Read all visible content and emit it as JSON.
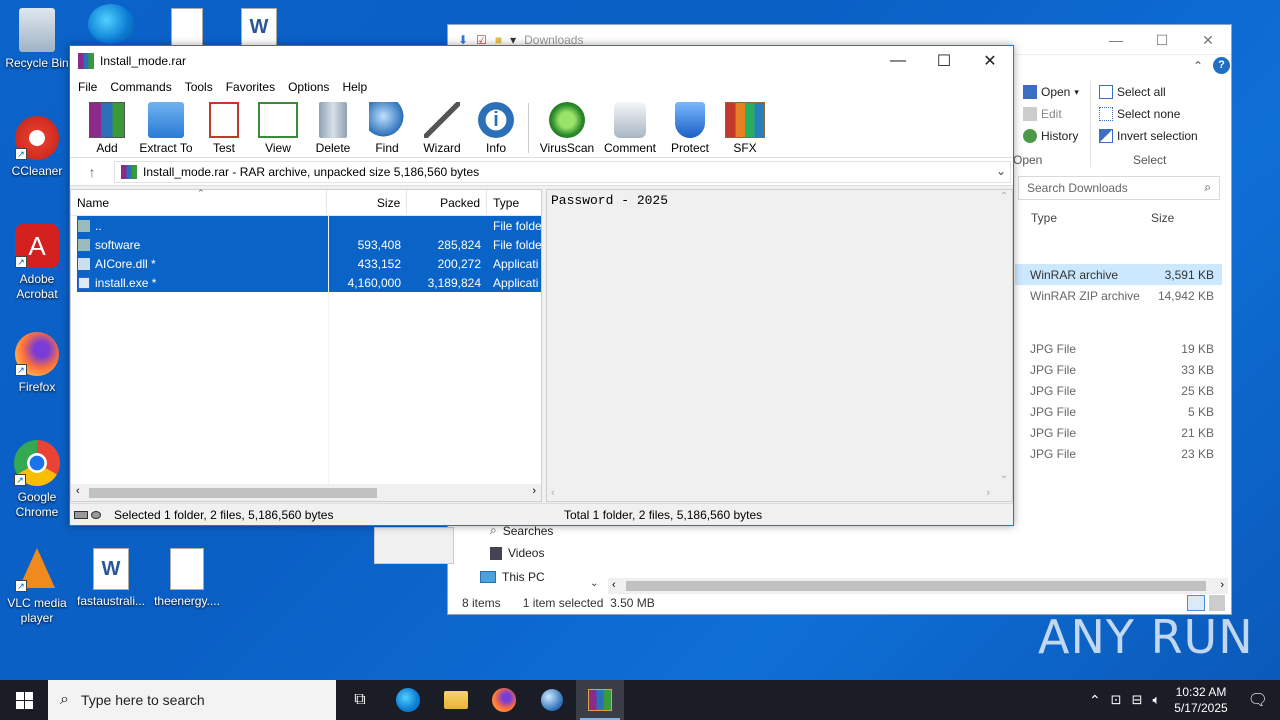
{
  "desktop": {
    "icons": [
      {
        "label": "Recycle Bin"
      },
      {
        "label": "CCleaner"
      },
      {
        "label": "Adobe Acrobat"
      },
      {
        "label": "Firefox"
      },
      {
        "label": "Google Chrome"
      },
      {
        "label": "VLC media player"
      },
      {
        "label": "fastaustrali..."
      },
      {
        "label": "theenergy...."
      }
    ]
  },
  "explorer": {
    "title": "Downloads",
    "ribbon": {
      "open": "Open",
      "edit": "Edit",
      "history": "History",
      "open_group": "Open",
      "select_all": "Select all",
      "select_none": "Select none",
      "invert_selection": "Invert selection",
      "select_group": "Select"
    },
    "search_placeholder": "Search Downloads",
    "columns": {
      "type": "Type",
      "size": "Size"
    },
    "files": [
      {
        "type": "WinRAR archive",
        "size": "3,591 KB",
        "selected": true
      },
      {
        "type": "WinRAR ZIP archive",
        "size": "14,942 KB"
      },
      {
        "type": "JPG File",
        "size": "19 KB"
      },
      {
        "type": "JPG File",
        "size": "33 KB"
      },
      {
        "type": "JPG File",
        "size": "25 KB"
      },
      {
        "type": "JPG File",
        "size": "5 KB"
      },
      {
        "type": "JPG File",
        "size": "21 KB"
      },
      {
        "type": "JPG File",
        "size": "23 KB"
      }
    ],
    "nav": {
      "searches": "Searches",
      "videos": "Videos",
      "this_pc": "This PC"
    },
    "status": {
      "items": "8 items",
      "selected": "1 item selected",
      "size": "3.50 MB"
    }
  },
  "winrar": {
    "title": "Install_mode.rar",
    "menu": [
      "File",
      "Commands",
      "Tools",
      "Favorites",
      "Options",
      "Help"
    ],
    "toolbar": [
      "Add",
      "Extract To",
      "Test",
      "View",
      "Delete",
      "Find",
      "Wizard",
      "Info",
      "VirusScan",
      "Comment",
      "Protect",
      "SFX"
    ],
    "address": "Install_mode.rar - RAR archive, unpacked size 5,186,560 bytes",
    "columns": {
      "name": "Name",
      "size": "Size",
      "packed": "Packed",
      "type": "Type"
    },
    "rows": [
      {
        "name": "..",
        "size": "",
        "packed": "",
        "type": "File folde"
      },
      {
        "name": "software",
        "size": "593,408",
        "packed": "285,824",
        "type": "File folde"
      },
      {
        "name": "AICore.dll *",
        "size": "433,152",
        "packed": "200,272",
        "type": "Applicati"
      },
      {
        "name": "install.exe *",
        "size": "4,160,000",
        "packed": "3,189,824",
        "type": "Applicati"
      }
    ],
    "comment": "Password - 2025",
    "status_left": "Selected 1 folder, 2 files, 5,186,560 bytes",
    "status_right": "Total 1 folder, 2 files, 5,186,560 bytes"
  },
  "taskbar": {
    "search_placeholder": "Type here to search",
    "time": "10:32 AM",
    "date": "5/17/2025"
  },
  "watermark": "ANY RUN"
}
